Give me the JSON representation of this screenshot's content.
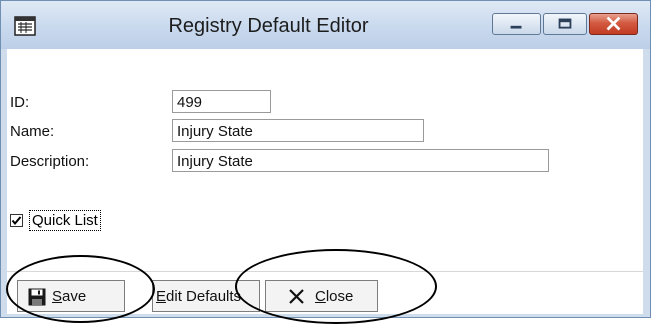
{
  "window": {
    "title": "Registry Default Editor",
    "accent_color": "#d04a30"
  },
  "form": {
    "id_label": "ID:",
    "id_value": "499",
    "name_label": "Name:",
    "name_value": "Injury State",
    "description_label": "Description:",
    "description_value": "Injury State",
    "quick_list_label": "Quick List",
    "quick_list_checked": true
  },
  "buttons": {
    "save_label": "Save",
    "edit_defaults_label": "Edit Defaults",
    "close_label": "Close"
  },
  "icons": {
    "app": "form-icon",
    "save": "floppy-disk-icon",
    "close": "x-icon",
    "minimize": "minimize-icon",
    "maximize": "maximize-icon",
    "window_close": "close-icon"
  }
}
